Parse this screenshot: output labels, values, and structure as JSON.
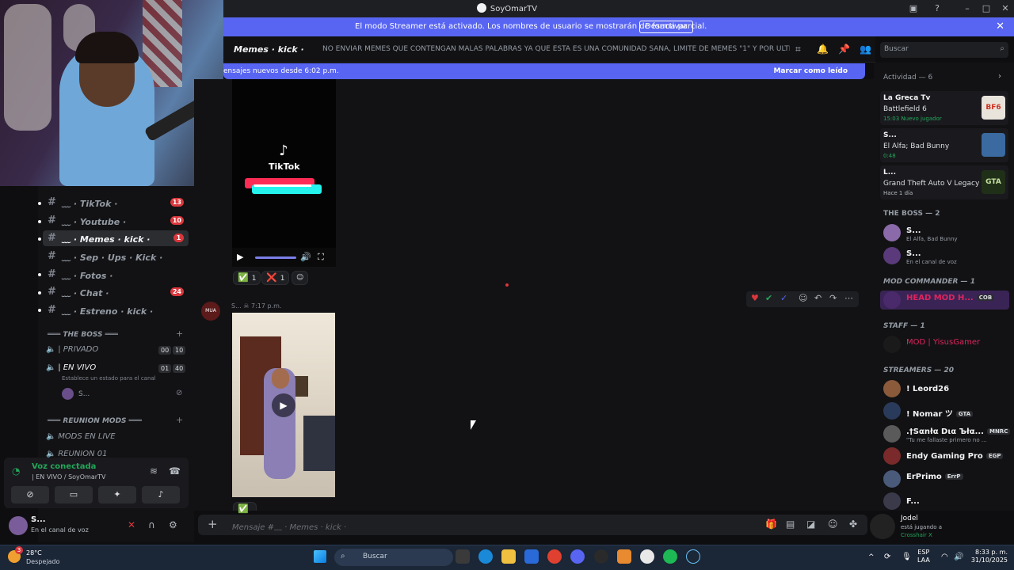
{
  "window": {
    "title": "SoyOmarTV"
  },
  "banner": {
    "text": "El modo Streamer está activado. Los nombres de usuario se mostrarán de forma parcial.",
    "button": "Desactivar"
  },
  "sidebar": {
    "channels": [
      {
        "name": "﹏ · TikTok ·",
        "badge": "13",
        "active": false
      },
      {
        "name": "﹏ · Youtube ·",
        "badge": "10",
        "active": false
      },
      {
        "name": "﹏ · Memes · kick ·",
        "badge": "1",
        "active": true
      },
      {
        "name": "﹏ · Sep · Ups · Kick ·",
        "badge": "",
        "active": false
      },
      {
        "name": "﹏ · Fotos ·",
        "badge": "",
        "active": false
      },
      {
        "name": "﹏ · Chat ·",
        "badge": "24",
        "active": false
      },
      {
        "name": "﹏ · Estreno · kick ·",
        "badge": "",
        "active": false
      }
    ],
    "category_boss": "═══ THE BOSS ═══",
    "voice_private": "| PRIVADO",
    "voice_private_counts": [
      "00",
      "10"
    ],
    "voice_live": "| EN VIVO",
    "voice_live_counts": [
      "01",
      "40"
    ],
    "voice_live_status": "Establece un estado para el canal",
    "voice_live_user": "S...",
    "category_mods": "═══ REUNION MODS ═══",
    "voice_mods_live": "MODS EN LIVE",
    "voice_reunion": "REUNION 01"
  },
  "voice_panel": {
    "status": "Voz conectada",
    "channel": "| EN VIVO / SoyOmarTV"
  },
  "user_panel": {
    "name": "S...",
    "status": "En el canal de voz"
  },
  "channel_header": {
    "name": "Memes · kick ·",
    "topic": "NO ENVIAR MEMES QUE CONTENGAN MALAS PALABRAS YA QUE ESTA ES UNA COMUNIDAD SANA, LIMITE DE MEMES \"1\" Y POR ULTIMO EL ..."
  },
  "search": {
    "placeholder": "Buscar"
  },
  "new_messages": {
    "text": "ensajes nuevos desde 6:02 p.m.",
    "action": "Marcar como leído"
  },
  "messages": {
    "tiktok_label": "TikTok",
    "reactions_1": [
      {
        "emoji": "✅",
        "count": "1"
      },
      {
        "emoji": "❌",
        "count": "1"
      }
    ],
    "msg2_author": "S...",
    "msg2_time": "7:17 p.m.",
    "avatar_text": "MUA"
  },
  "composer": {
    "placeholder": "Mensaje #﹏ · Memes · kick ·"
  },
  "members": {
    "activity_header": "Actividad — 6",
    "activities": [
      {
        "title": "La Greca Tv",
        "game": "Battlefield 6",
        "sub": "15:03  Nuevo jugador",
        "thumb": "BF6"
      },
      {
        "title": "S...",
        "game": "El Alfa; Bad Bunny",
        "sub": "0:48",
        "thumb": ""
      },
      {
        "title": "L...",
        "game": "Grand Theft Auto V Legacy",
        "sub": "Hace 1 día",
        "thumb": "GTA"
      }
    ],
    "boss_header": "THE BOSS — 2",
    "boss": [
      {
        "name": "S...",
        "sub": "El Alfa, Bad Bunny"
      },
      {
        "name": "S...",
        "sub": "En el canal de voz"
      }
    ],
    "mod_header": "MOD COMMANDER — 1",
    "mod": [
      {
        "name": "HEAD MOD H...",
        "tag": "COB"
      }
    ],
    "staff_header": "STAFF — 1",
    "staff": [
      {
        "name": "MOD | YisusGamer"
      }
    ],
    "streamers_header": "STREAMERS — 20",
    "streamers": [
      {
        "name": "! Leord26",
        "tag": "",
        "sub": ""
      },
      {
        "name": "! Nomar ツ",
        "tag": "GTA",
        "sub": ""
      },
      {
        "name": ".†Sαnłα Dια Ъłα...",
        "tag": "MNRC",
        "sub": "\"Tu me fallaste primero no ..."
      },
      {
        "name": "Endy Gaming Pro",
        "tag": "EGP",
        "sub": ""
      },
      {
        "name": "ErPrimo",
        "tag": "ErrP",
        "sub": ""
      },
      {
        "name": "F...",
        "tag": "",
        "sub": ""
      }
    ]
  },
  "now_playing": {
    "name": "Jodel",
    "line1": "está jugando a",
    "line2": "Crosshair X"
  },
  "taskbar": {
    "temp": "28°C",
    "weather": "Despejado",
    "search": "Buscar",
    "lang1": "ESP",
    "lang2": "LAA",
    "time": "8:33 p. m.",
    "date": "31/10/2025",
    "weather_badge": "3"
  },
  "colors": {
    "accent": "#5865f2",
    "background": "#121214",
    "online": "#23a55a",
    "danger": "#da373c"
  }
}
